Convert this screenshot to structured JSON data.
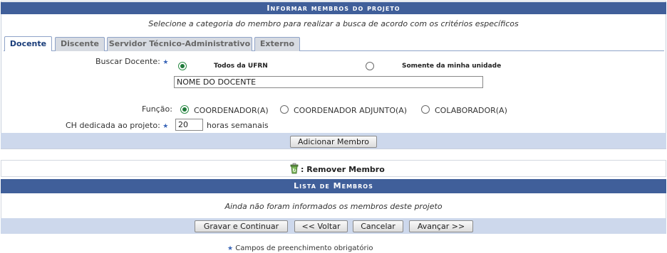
{
  "header": {
    "title": "Informar membros do projeto"
  },
  "subtitle": "Selecione a categoria do membro para realizar a busca de acordo com os critérios específicos",
  "tabs": [
    {
      "label": "Docente"
    },
    {
      "label": "Discente"
    },
    {
      "label": "Servidor Técnico-Administrativo"
    },
    {
      "label": "Externo"
    }
  ],
  "form": {
    "buscar_label": "Buscar Docente:",
    "option_todos": "Todos da UFRN",
    "option_unidade": "Somente da minha unidade",
    "nome_value": "NOME DO DOCENTE",
    "funcao_label": "Função:",
    "funcoes": [
      "COORDENADOR(A)",
      "COORDENADOR ADJUNTO(A)",
      "COLABORADOR(A)"
    ],
    "ch_label": "CH dedicada ao projeto:",
    "ch_value": "20",
    "ch_unit": "horas semanais",
    "add_button": "Adicionar Membro"
  },
  "legend": {
    "remove_label": ": Remover Membro",
    "remove_icon": "trash-icon"
  },
  "lista": {
    "title": "Lista de Membros",
    "empty_message": "Ainda não foram informados os membros deste projeto"
  },
  "footer_buttons": {
    "save": "Gravar e Continuar",
    "back": "<< Voltar",
    "cancel": "Cancelar",
    "next": "Avançar >>"
  },
  "required_note": "Campos de preenchimento obrigatório",
  "colors": {
    "header_bg": "#405f9a",
    "bar_bg": "#cdd8ec",
    "star": "#3a66b8"
  }
}
